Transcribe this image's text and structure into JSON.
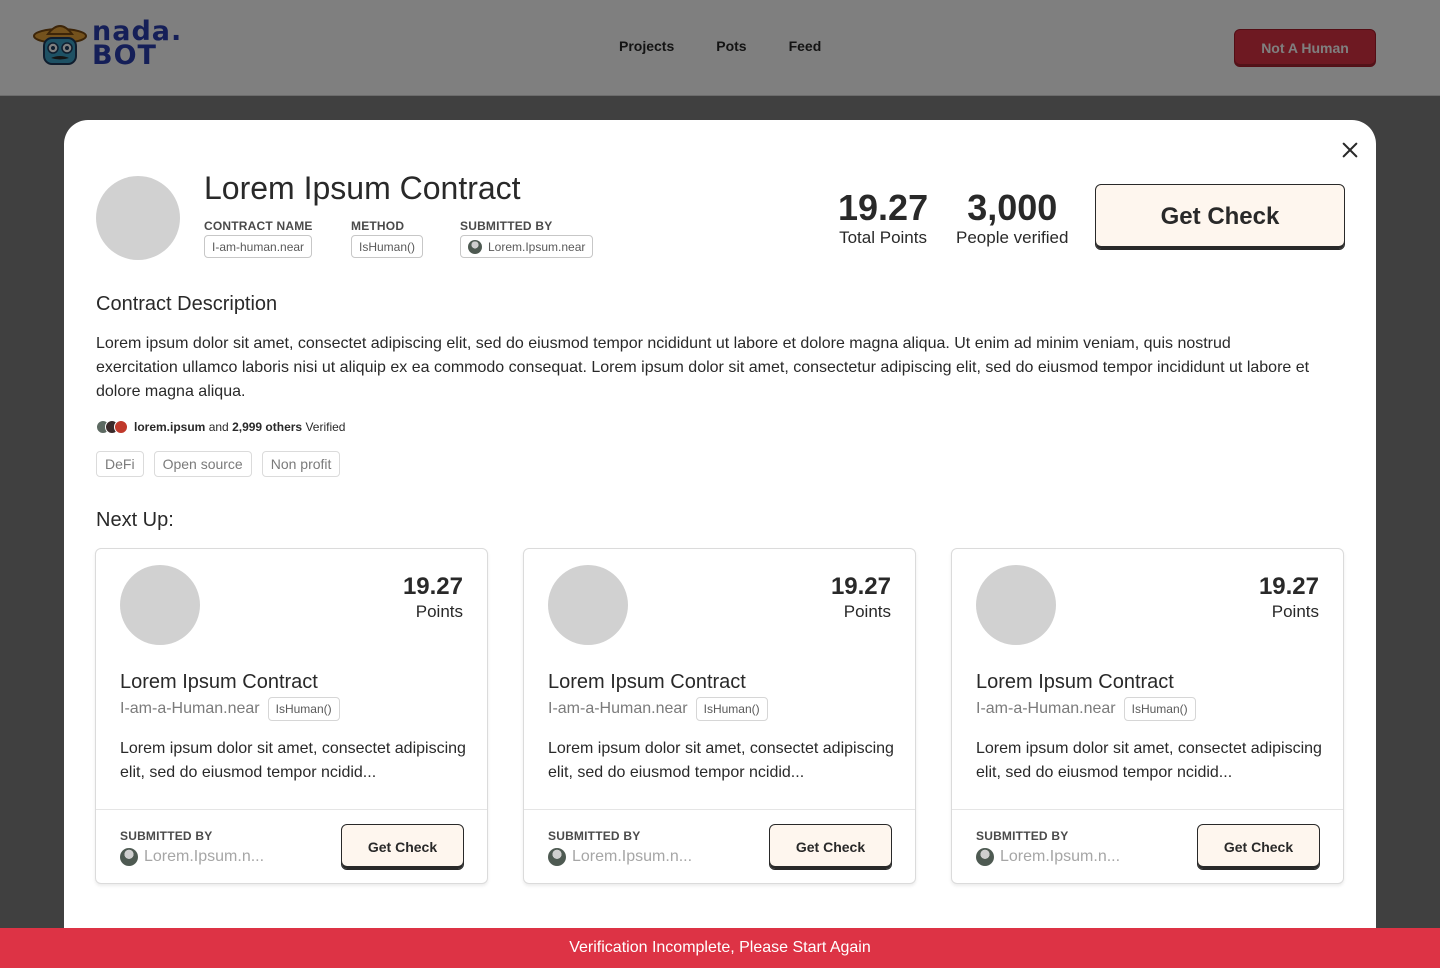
{
  "header": {
    "logo_line1": "nada.",
    "logo_line2": "BOT",
    "nav": [
      "Projects",
      "Pots",
      "Feed"
    ],
    "cta": "Not A Human"
  },
  "modal": {
    "title": "Lorem Ipsum Contract",
    "meta": {
      "contract_name_label": "CONTRACT NAME",
      "contract_name": "I-am-human.near",
      "method_label": "METHOD",
      "method": "IsHuman()",
      "submitted_by_label": "SUBMITTED BY",
      "submitted_by": "Lorem.Ipsum.near"
    },
    "stats": {
      "points_value": "19.27",
      "points_label": "Total Points",
      "people_value": "3,000",
      "people_label": "People verified"
    },
    "get_check_label": "Get Check",
    "description_title": "Contract Description",
    "description": "Lorem ipsum dolor sit amet, consectet adipiscing elit, sed do eiusmod tempor ncididunt ut labore et dolore magna aliqua. Ut enim ad minim veniam, quis nostrud exercitation ullamco laboris nisi ut aliquip ex ea commodo consequat. Lorem ipsum dolor sit amet, consectetur adipiscing elit, sed do eiusmod tempor incididunt ut labore et dolore magna aliqua.",
    "verified": {
      "user": "lorem.ipsum",
      "and_text": " and ",
      "others": "2,999 others",
      "suffix": " Verified"
    },
    "tags": [
      "DeFi",
      "Open source",
      "Non profit"
    ],
    "next_up_title": "Next Up:",
    "cards": [
      {
        "points_value": "19.27",
        "points_label": "Points",
        "title": "Lorem Ipsum Contract",
        "near": "I-am-a-Human.near",
        "method": "IsHuman()",
        "description": "Lorem ipsum dolor sit amet, consectet adipiscing elit, sed do eiusmod tempor ncidid...",
        "submitted_label": "SUBMITTED BY",
        "submitted_by": "Lorem.Ipsum.n...",
        "button": "Get Check"
      },
      {
        "points_value": "19.27",
        "points_label": "Points",
        "title": "Lorem Ipsum Contract",
        "near": "I-am-a-Human.near",
        "method": "IsHuman()",
        "description": "Lorem ipsum dolor sit amet, consectet adipiscing elit, sed do eiusmod tempor ncidid...",
        "submitted_label": "SUBMITTED BY",
        "submitted_by": "Lorem.Ipsum.n...",
        "button": "Get Check"
      },
      {
        "points_value": "19.27",
        "points_label": "Points",
        "title": "Lorem Ipsum Contract",
        "near": "I-am-a-Human.near",
        "method": "IsHuman()",
        "description": "Lorem ipsum dolor sit amet, consectet adipiscing elit, sed do eiusmod tempor ncidid...",
        "submitted_label": "SUBMITTED BY",
        "submitted_by": "Lorem.Ipsum.n...",
        "button": "Get Check"
      }
    ]
  },
  "toast": "Verification Incomplete, Please Start Again",
  "colors": {
    "accent_red": "#dd3345",
    "button_cream": "#fef6ee",
    "text": "#292929",
    "placeholder_gray": "#d1d1d1"
  },
  "icons": [
    "sombrero-mascot-icon",
    "close-icon",
    "user-avatar-icon"
  ]
}
